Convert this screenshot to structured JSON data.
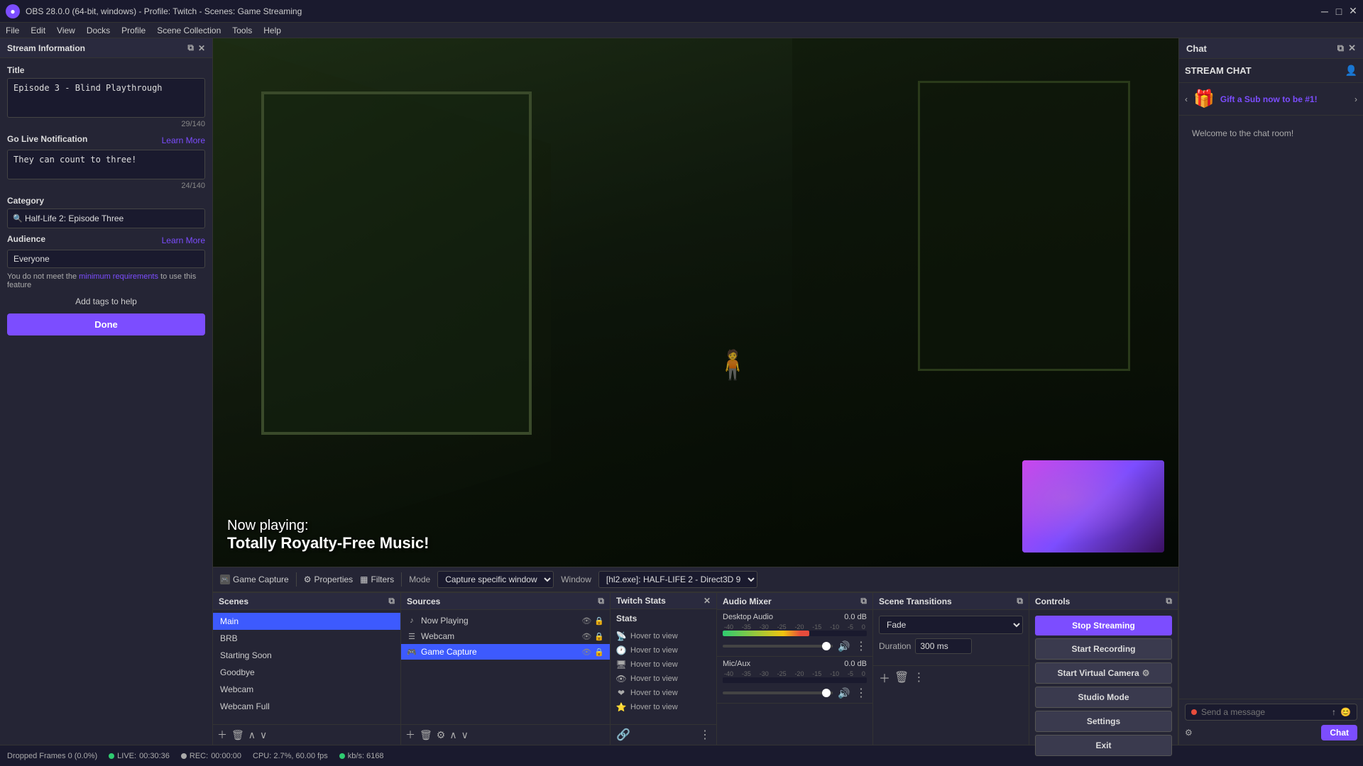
{
  "titlebar": {
    "icon": "●",
    "title": "OBS 28.0.0 (64-bit, windows) - Profile: Twitch - Scenes: Game Streaming",
    "minimize": "─",
    "maximize": "□",
    "close": "✕"
  },
  "menubar": {
    "items": [
      "File",
      "Edit",
      "View",
      "Docks",
      "Profile",
      "Scene Collection",
      "Tools",
      "Help"
    ]
  },
  "stream_info": {
    "panel_title": "Stream Information",
    "title_label": "Title",
    "title_value": "Episode 3 - Blind Playthrough",
    "title_char_count": "29/140",
    "go_live_label": "Go Live Notification",
    "learn_more": "Learn More",
    "go_live_value": "They can count to three!",
    "go_live_char_count": "24/140",
    "category_label": "Category",
    "category_placeholder": "Half-Life 2: Episode Three",
    "audience_label": "Audience",
    "audience_learn_more": "Learn More",
    "audience_value": "Everyone",
    "audience_note1": "You do not meet the",
    "audience_link": "minimum requirements",
    "audience_note2": "to use this feature",
    "add_tags_text": "Add tags to help",
    "done_btn": "Done"
  },
  "preview": {
    "now_playing_label": "Now playing:",
    "song_title": "Totally Royalty-Free Music!",
    "toolbar": {
      "game_capture": "Game Capture",
      "properties": "Properties",
      "filters": "Filters",
      "mode_label": "Mode",
      "capture_specific": "Capture specific window",
      "window_label": "Window",
      "window_value": "[hl2.exe]: HALF-LIFE 2 - Direct3D 9"
    }
  },
  "scenes": {
    "panel_title": "Scenes",
    "items": [
      {
        "name": "Main",
        "active": true
      },
      {
        "name": "BRB",
        "active": false
      },
      {
        "name": "Starting Soon",
        "active": false
      },
      {
        "name": "Goodbye",
        "active": false
      },
      {
        "name": "Webcam",
        "active": false
      },
      {
        "name": "Webcam Full",
        "active": false
      }
    ]
  },
  "sources": {
    "panel_title": "Sources",
    "items": [
      {
        "name": "Now Playing",
        "icon": "♪",
        "active": false
      },
      {
        "name": "Webcam",
        "icon": "☰",
        "active": false
      },
      {
        "name": "Game Capture",
        "icon": "🎮",
        "active": true
      }
    ]
  },
  "twitch_stats": {
    "panel_title": "Twitch Stats",
    "stats_label": "Stats",
    "items": [
      {
        "icon": "📡",
        "label": "Hover to view"
      },
      {
        "icon": "🕐",
        "label": "Hover to view"
      },
      {
        "icon": "🖥",
        "label": "Hover to view"
      },
      {
        "icon": "👁",
        "label": "Hover to view"
      },
      {
        "icon": "❤",
        "label": "Hover to view"
      },
      {
        "icon": "⭐",
        "label": "Hover to view"
      }
    ]
  },
  "audio_mixer": {
    "panel_title": "Audio Mixer",
    "channels": [
      {
        "name": "Desktop Audio",
        "db": "0.0 dB",
        "level": 60
      },
      {
        "name": "Mic/Aux",
        "db": "0.0 dB",
        "level": 0
      }
    ]
  },
  "scene_transitions": {
    "panel_title": "Scene Transitions",
    "transition_type": "Fade",
    "duration_label": "Duration",
    "duration_value": "300 ms"
  },
  "controls": {
    "panel_title": "Controls",
    "stop_streaming": "Stop Streaming",
    "start_recording": "Start Recording",
    "start_virtual_camera": "Start Virtual Camera",
    "studio_mode": "Studio Mode",
    "settings": "Settings",
    "exit": "Exit"
  },
  "chat": {
    "panel_title": "Chat",
    "stream_chat_label": "STREAM CHAT",
    "gift_text": "Gift a Sub now to be #1!",
    "welcome_text": "Welcome to the chat room!",
    "input_placeholder": "Send a message",
    "chat_btn": "Chat"
  },
  "statusbar": {
    "dropped_frames": "Dropped Frames 0 (0.0%)",
    "live_label": "LIVE:",
    "live_time": "00:30:36",
    "rec_label": "REC:",
    "rec_time": "00:00:00",
    "cpu": "CPU: 2.7%, 60.00 fps",
    "kbps": "kb/s: 6168"
  },
  "audio_ticks": [
    "-40",
    "-35",
    "-30",
    "-25",
    "-20",
    "-15",
    "-10",
    "-5",
    "0"
  ]
}
